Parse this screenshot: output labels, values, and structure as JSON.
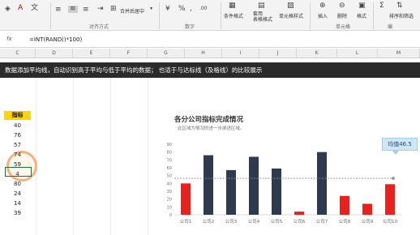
{
  "ribbon": {
    "merge_center_label": "合并后居中",
    "conditional_format_label": "条件格式",
    "format_as_table_label": "套用\n表格格式",
    "cell_styles_label": "单元格样式",
    "insert_label": "插入",
    "delete_label": "删除",
    "format_label": "格式",
    "sort_filter_label": "排序和筛选",
    "group_alignment": "对齐方式",
    "group_number": "数字",
    "group_cells": "单元格",
    "group_editing": "编"
  },
  "formula_bar": {
    "fx_icon": "fx",
    "formula": "=INT(RAND()*100)"
  },
  "columns": [
    "C",
    "D",
    "E",
    "F",
    "G",
    "H",
    "I",
    "J",
    "K",
    "L",
    "M"
  ],
  "banner": {
    "text": "数据添加平均线，自动识别高于平均与低于平均的数据； 也适于与达标线（及格线）的比较展示"
  },
  "data_column": {
    "header": "指标",
    "values": [
      "40",
      "76",
      "57",
      "74",
      "59",
      "4",
      "80",
      "24",
      "14",
      "39"
    ]
  },
  "chart_data": {
    "type": "bar",
    "title": "各分公司指标完成情况",
    "subtitle": "此区域为情况的进一步阐述区域。",
    "categories": [
      "公司1",
      "公司2",
      "公司3",
      "公司4",
      "公司5",
      "公司6",
      "公司7",
      "公司8",
      "公司9",
      "公司10"
    ],
    "values": [
      40,
      76,
      57,
      74,
      59,
      4,
      80,
      24,
      14,
      39
    ],
    "average": 46.5,
    "average_label": "均值46.5",
    "yticks": [
      "0",
      "10",
      "20",
      "30",
      "40",
      "50",
      "60",
      "70",
      "80",
      "90"
    ],
    "ylim": [
      0,
      90
    ],
    "colors": {
      "above": "#2e3b4e",
      "below": "#e8211f",
      "avg_line": "#8a8a8a"
    }
  }
}
